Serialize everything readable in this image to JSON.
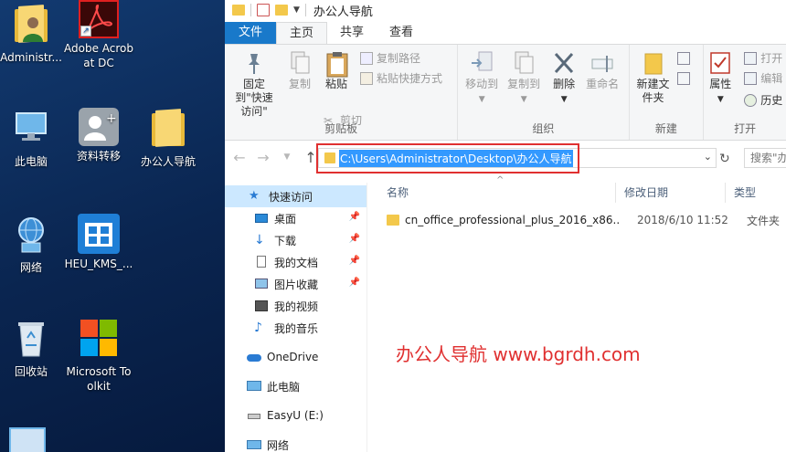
{
  "desktop": {
    "icons": [
      {
        "label": "Administr..."
      },
      {
        "label": "Adobe Acrobat DC"
      },
      {
        "label": "此电脑"
      },
      {
        "label": "资料转移"
      },
      {
        "label": "办公人导航"
      },
      {
        "label": "网络"
      },
      {
        "label": "HEU_KMS_..."
      },
      {
        "label": "回收站"
      },
      {
        "label": "Microsoft Toolkit"
      }
    ]
  },
  "explorer": {
    "title": "办公人导航",
    "tabs": [
      "文件",
      "主页",
      "共享",
      "查看"
    ],
    "ribbon": {
      "clipboard": {
        "pin_label": "固定到\"快速访问\"",
        "copy_label": "复制",
        "paste_label": "粘贴",
        "copy_path_label": "复制路径",
        "paste_shortcut_label": "粘贴快捷方式",
        "cut_label": "剪切",
        "group_label": "剪贴板"
      },
      "organize": {
        "move_to_label": "移动到",
        "copy_to_label": "复制到",
        "delete_label": "删除",
        "rename_label": "重命名",
        "group_label": "组织"
      },
      "new": {
        "new_folder_label": "新建文件夹",
        "group_label": "新建"
      },
      "open": {
        "properties_label": "属性",
        "open_label": "打开",
        "edit_label": "编辑",
        "history_label": "历史",
        "group_label": "打开"
      }
    },
    "address": {
      "path": "C:\\Users\\Administrator\\Desktop\\办公人导航",
      "search_placeholder": "搜索\"办"
    },
    "nav": {
      "items": [
        {
          "label": "快速访问",
          "icon": "star-icon"
        },
        {
          "label": "桌面",
          "icon": "desktop-icon"
        },
        {
          "label": "下载",
          "icon": "download-icon"
        },
        {
          "label": "我的文档",
          "icon": "documents-icon"
        },
        {
          "label": "图片收藏",
          "icon": "pictures-icon"
        },
        {
          "label": "我的视频",
          "icon": "videos-icon"
        },
        {
          "label": "我的音乐",
          "icon": "music-icon"
        },
        {
          "label": "OneDrive",
          "icon": "cloud-icon"
        },
        {
          "label": "此电脑",
          "icon": "computer-icon"
        },
        {
          "label": "EasyU (E:)",
          "icon": "drive-icon"
        },
        {
          "label": "网络",
          "icon": "network-icon"
        }
      ]
    },
    "columns": {
      "name": "名称",
      "modified": "修改日期",
      "type": "类型"
    },
    "files": [
      {
        "name": "cn_office_professional_plus_2016_x86...",
        "modified": "2018/6/10 11:52",
        "type": "文件夹"
      }
    ],
    "watermark": "办公人导航  www.bgrdh.com"
  },
  "colors": {
    "accent": "#1979ca",
    "highlight": "#e03030",
    "selection": "#3399ff",
    "folder": "#f3c84b"
  }
}
